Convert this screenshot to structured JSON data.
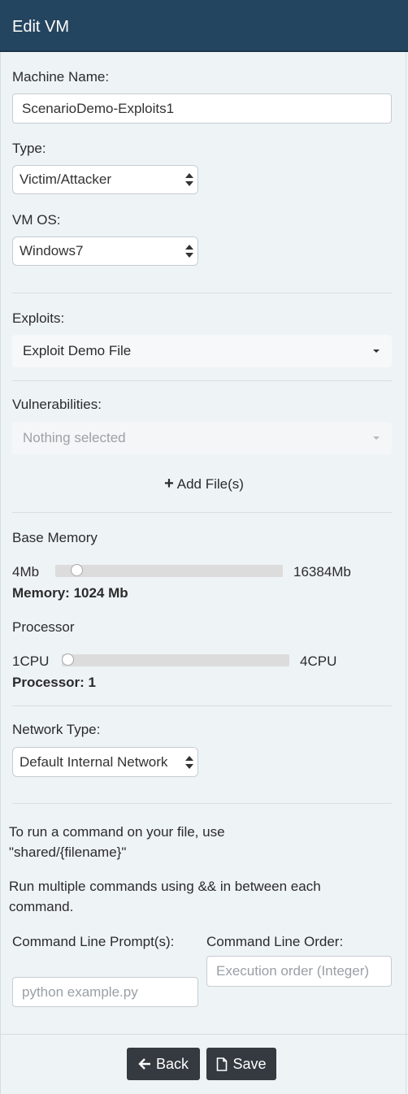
{
  "header": {
    "title": "Edit VM"
  },
  "form": {
    "machine_name_label": "Machine Name:",
    "machine_name_value": "ScenarioDemo-Exploits1",
    "type_label": "Type:",
    "type_value": "Victim/Attacker",
    "vm_os_label": "VM OS:",
    "vm_os_value": "Windows7",
    "exploits_label": "Exploits:",
    "exploits_value": "Exploit Demo File",
    "vulnerabilities_label": "Vulnerabilities:",
    "vulnerabilities_value": "Nothing selected",
    "add_files_label": "Add File(s)",
    "base_memory_label": "Base Memory",
    "memory_min": "4Mb",
    "memory_max": "16384Mb",
    "memory_readout": "Memory: 1024 Mb",
    "memory_value": 1024,
    "processor_label": "Processor",
    "processor_min": "1CPU",
    "processor_max": "4CPU",
    "processor_readout": "Processor: 1",
    "processor_value": 1,
    "network_type_label": "Network Type:",
    "network_type_value": "Default Internal Network",
    "help_text_1": "To run a command on your file, use \"shared/{filename}\"",
    "help_text_2": "Run multiple commands using && in between each command.",
    "command_prompt_label": "Command Line Prompt(s):",
    "command_prompt_placeholder": "python example.py",
    "command_order_label": "Command Line Order:",
    "command_order_placeholder": "Execution order (Integer)"
  },
  "footer": {
    "back_label": "Back",
    "save_label": "Save"
  },
  "colors": {
    "header_bg": "#24455f",
    "page_bg": "#eef3f6",
    "button_bg": "#343a40"
  }
}
